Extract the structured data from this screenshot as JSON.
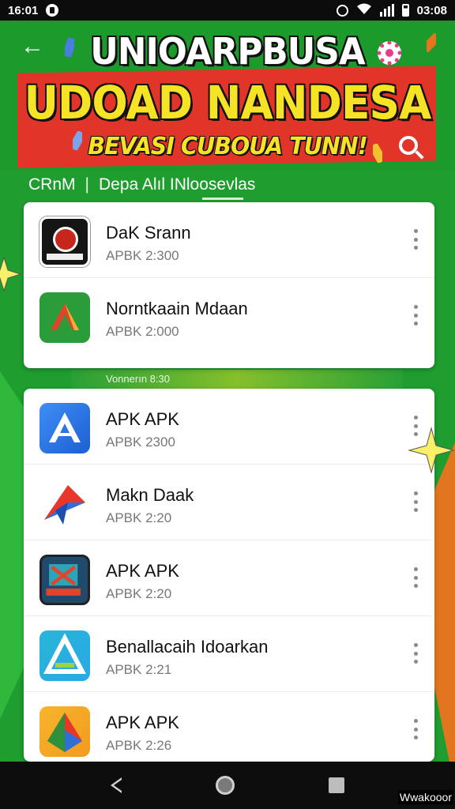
{
  "status_bar": {
    "time": "16:01",
    "clock": "03:08"
  },
  "banner": {
    "line1": "UNIOARPBUSA",
    "line2": "UDOAD NANDESA",
    "line3": "BEVASI CUBOUA TUNN!"
  },
  "tabs": {
    "left": "CRnM",
    "separator": "|",
    "right": "Depa Alıl INloosevlas"
  },
  "section_caption": "Vonnerın 8:30",
  "cards": [
    {
      "items": [
        {
          "title": "DaK Srann",
          "subtitle": "APBK 2:300",
          "icon": "dark-badge-icon"
        },
        {
          "title": "Norntkaain Mdaan",
          "subtitle": "APBK 2:000",
          "icon": "green-arrow-icon"
        }
      ]
    },
    {
      "items": [
        {
          "title": "APK APK",
          "subtitle": "APBK 2300",
          "icon": "blue-a-icon"
        },
        {
          "title": "Makn Daak",
          "subtitle": "APBK 2:20",
          "icon": "red-paper-plane-icon"
        },
        {
          "title": "APK APK",
          "subtitle": "APBK 2:20",
          "icon": "navy-badge-icon"
        },
        {
          "title": "Benallacaih Idoarkan",
          "subtitle": "APBK 2:21",
          "icon": "teal-triangle-icon"
        },
        {
          "title": "APK APK",
          "subtitle": "APBK 2:26",
          "icon": "orange-drive-icon"
        }
      ]
    }
  ],
  "watermark": "Wwakooor",
  "colors": {
    "background": "#1f9d2f",
    "banner_red": "#e1352a",
    "title_yellow": "#f7e325"
  }
}
